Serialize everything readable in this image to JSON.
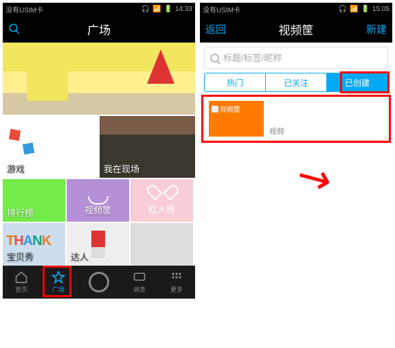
{
  "left": {
    "status": {
      "carrier": "没有USIM卡",
      "time": "14:33"
    },
    "header": {
      "title": "广场"
    },
    "tiles": {
      "games": "游戏",
      "live": "我在现场",
      "rank": "排行榜",
      "videobasket": "视频筐",
      "redlist": "红人榜",
      "baby": "宝贝秀",
      "star": "达人"
    },
    "nav": {
      "home": "首页",
      "square": "广场",
      "msg": "消息",
      "more": "更多"
    }
  },
  "right": {
    "status": {
      "carrier": "没有USIM卡",
      "time": "15:05"
    },
    "header": {
      "back": "返回",
      "title": "视频筐",
      "new": "新建"
    },
    "search_placeholder": "标题/标签/昵称",
    "tabs": {
      "hot": "热门",
      "followed": "已关注",
      "created": "已创建"
    },
    "item": {
      "tag": "视频筐",
      "meta": "视频"
    }
  }
}
